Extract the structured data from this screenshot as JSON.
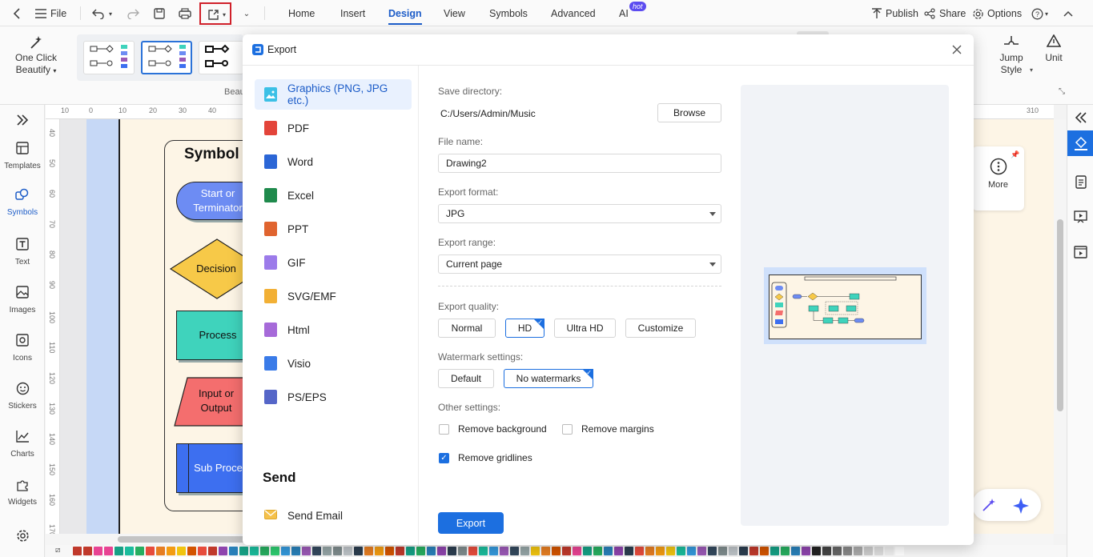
{
  "topbar": {
    "file_label": "File",
    "menus": [
      "Home",
      "Insert",
      "Design",
      "View",
      "Symbols",
      "Advanced",
      "AI"
    ],
    "active_menu": "Design",
    "hot_badge": "hot",
    "publish_label": "Publish",
    "share_label": "Share",
    "options_label": "Options"
  },
  "ribbon": {
    "one_click_beautify": "One Click Beautify",
    "beautify_group": "Beau",
    "jump_style": "Jump Style",
    "unit": "Unit"
  },
  "leftrail": {
    "items": [
      "Templates",
      "Symbols",
      "Text",
      "Images",
      "Icons",
      "Stickers",
      "Charts",
      "Widgets"
    ],
    "active": "Symbols"
  },
  "rulers": {
    "top": [
      "10",
      "0",
      "10",
      "20",
      "30",
      "40",
      "310"
    ],
    "left": [
      "40",
      "50",
      "60",
      "70",
      "80",
      "90",
      "100",
      "110",
      "120",
      "130",
      "140",
      "150",
      "160",
      "170"
    ]
  },
  "canvas": {
    "panel_title": "Symbol",
    "shapes": [
      "Start or Terminator",
      "Decision",
      "Process",
      "Input or Output",
      "Sub Process"
    ]
  },
  "more_card": {
    "label": "More"
  },
  "dialog": {
    "title": "Export",
    "formats": [
      "Graphics (PNG, JPG etc.)",
      "PDF",
      "Word",
      "Excel",
      "PPT",
      "GIF",
      "SVG/EMF",
      "Html",
      "Visio",
      "PS/EPS"
    ],
    "active_format": "Graphics (PNG, JPG etc.)",
    "send_heading": "Send",
    "send_email": "Send Email",
    "save_directory_label": "Save directory:",
    "save_directory_value": "C:/Users/Admin/Music",
    "browse_label": "Browse",
    "file_name_label": "File name:",
    "file_name_value": "Drawing2",
    "export_format_label": "Export format:",
    "export_format_value": "JPG",
    "export_range_label": "Export range:",
    "export_range_value": "Current page",
    "export_quality_label": "Export quality:",
    "quality_options": [
      "Normal",
      "HD",
      "Ultra HD",
      "Customize"
    ],
    "quality_selected": "HD",
    "watermark_label": "Watermark settings:",
    "watermark_options": [
      "Default",
      "No watermarks"
    ],
    "watermark_selected": "No watermarks",
    "other_label": "Other settings:",
    "remove_background": "Remove background",
    "remove_background_checked": false,
    "remove_margins": "Remove margins",
    "remove_margins_checked": false,
    "remove_gridlines": "Remove gridlines",
    "remove_gridlines_checked": true,
    "export_button": "Export"
  },
  "colors": {
    "accent": "#1c6fe0",
    "highlight_box": "#d0202a",
    "terminator": "#6d8cf3",
    "decision": "#f7c948",
    "process": "#3fd3bc",
    "io": "#f46e6e",
    "subprocess": "#3d6ff0"
  },
  "palette": [
    "#c0392b",
    "#c0392b",
    "#e84393",
    "#e84393",
    "#16a085",
    "#1abc9c",
    "#27ae60",
    "#e74c3c",
    "#e67e22",
    "#f39c12",
    "#f1c40f",
    "#d35400",
    "#e74c3c",
    "#c0392b",
    "#8e44ad",
    "#2980b9",
    "#16a085",
    "#1abc9c",
    "#27ae60",
    "#2ecc71",
    "#3498db",
    "#2980b9",
    "#9b59b6",
    "#34495e",
    "#95a5a6",
    "#7f8c8d",
    "#bdc3c7",
    "#2c3e50",
    "#e67e22",
    "#f39c12",
    "#d35400",
    "#c0392b",
    "#16a085",
    "#27ae60",
    "#2980b9",
    "#8e44ad",
    "#2c3e50",
    "#7f8c8d",
    "#e74c3c",
    "#1abc9c",
    "#3498db",
    "#9b59b6",
    "#34495e",
    "#95a5a6",
    "#f1c40f",
    "#e67e22",
    "#d35400",
    "#c0392b",
    "#e84393",
    "#16a085",
    "#27ae60",
    "#2980b9",
    "#8e44ad",
    "#2c3e50",
    "#e74c3c",
    "#e67e22",
    "#f39c12",
    "#f1c40f",
    "#1abc9c",
    "#3498db",
    "#9b59b6",
    "#34495e",
    "#7f8c8d",
    "#bdc3c7",
    "#2c3e50",
    "#c0392b",
    "#d35400",
    "#16a085",
    "#27ae60",
    "#2980b9",
    "#8e44ad",
    "#222222",
    "#444444",
    "#666666",
    "#888888",
    "#aaaaaa",
    "#cccccc",
    "#dddddd",
    "#eeeeee",
    "#ffffff"
  ]
}
